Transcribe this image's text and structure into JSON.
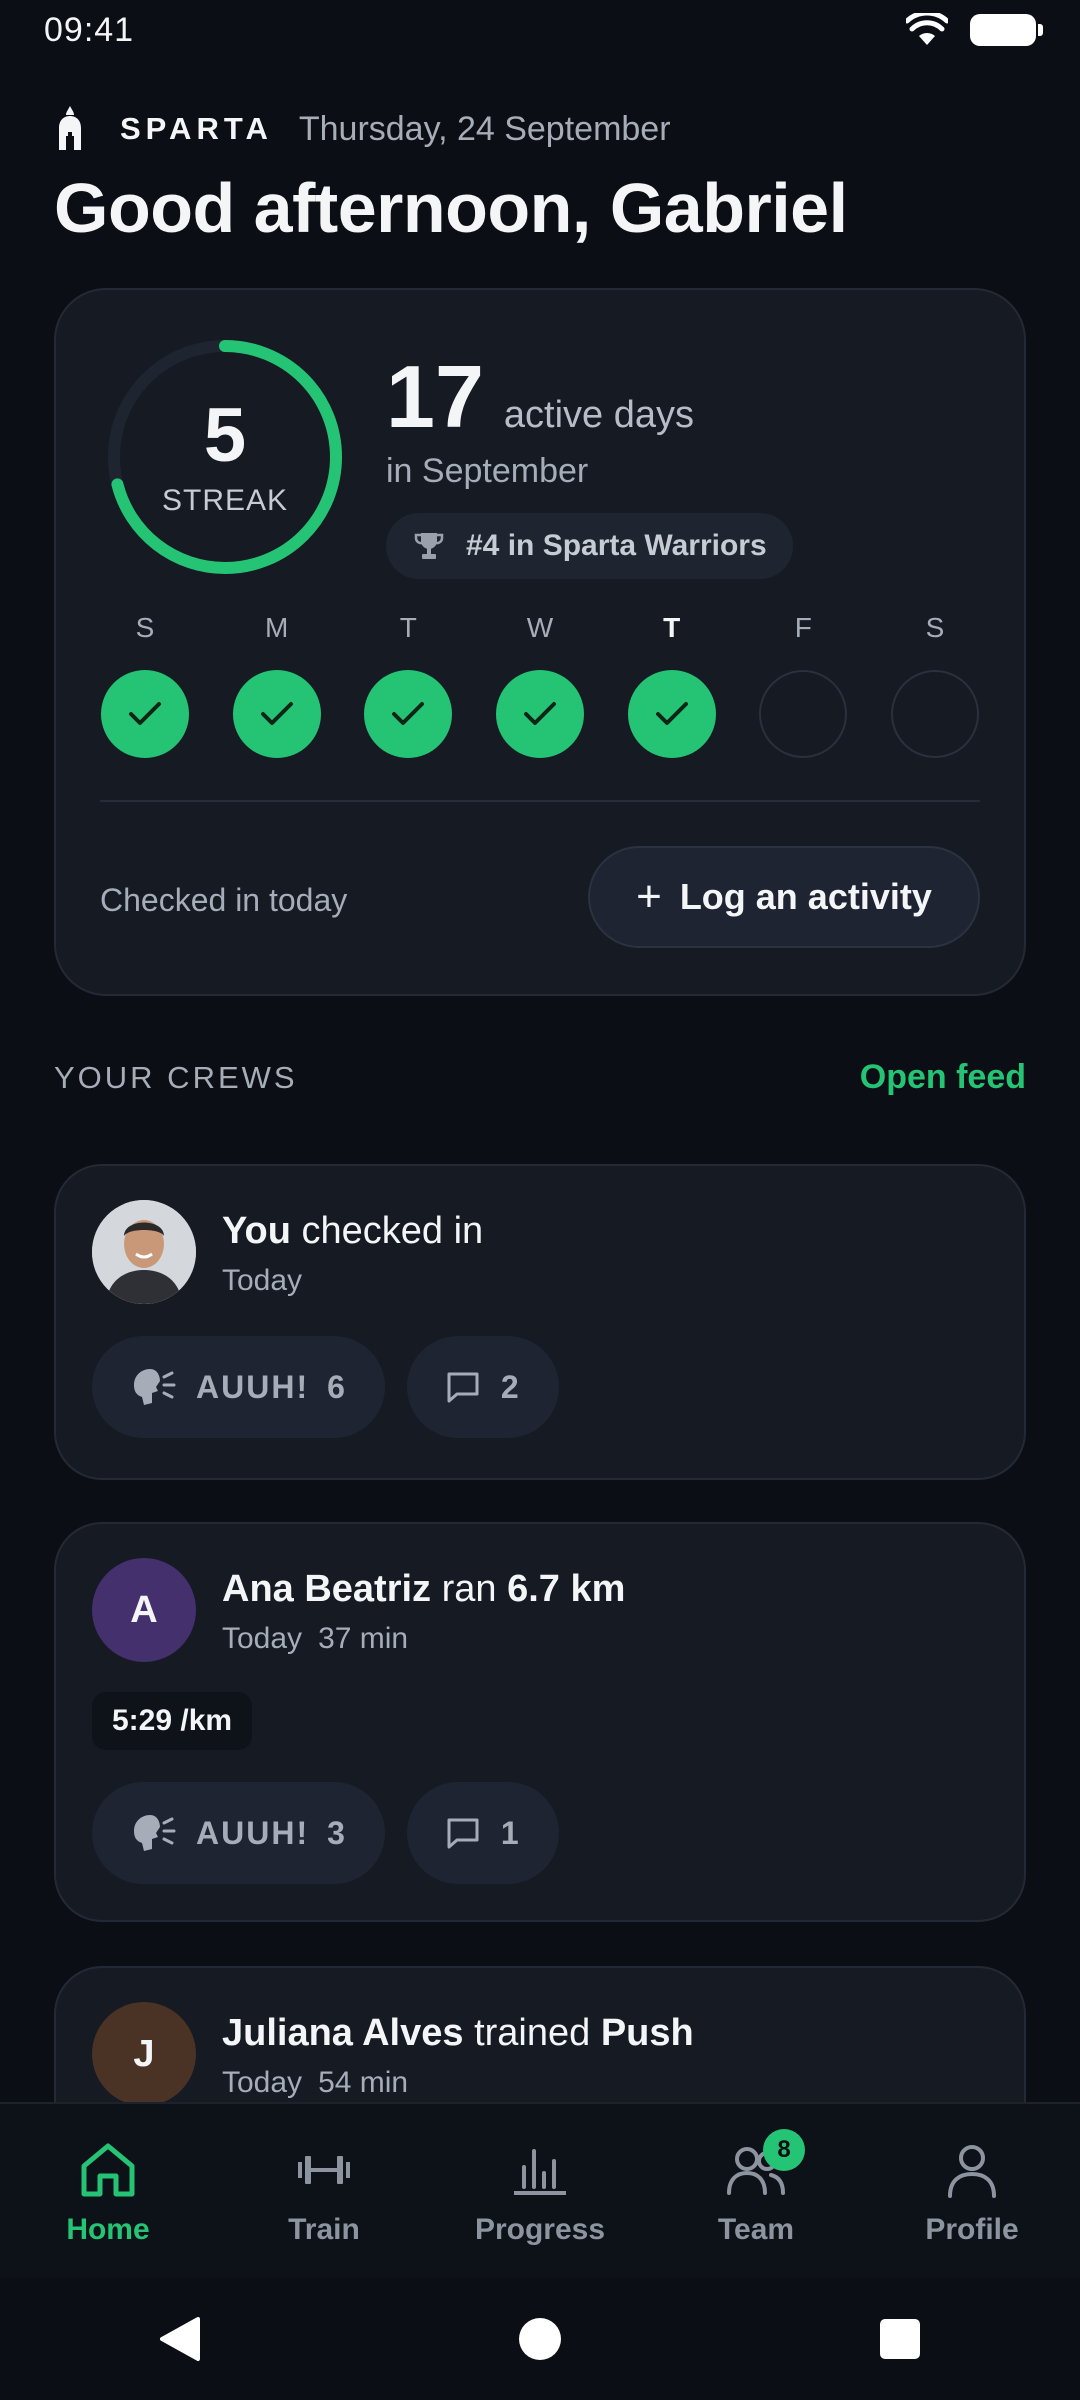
{
  "status_bar": {
    "time": "09:41",
    "wifi_icon": "wifi-icon",
    "battery_icon": "battery-icon"
  },
  "header": {
    "brand": "SPARTA",
    "date": "Thursday, 24 September",
    "greeting": "Good afternoon, Gabriel"
  },
  "streak": {
    "value": "5",
    "label": "STREAK",
    "progress": 0.71,
    "active_days": "17",
    "active_unit": "active days",
    "period": "in September",
    "rank": "#4 in Sparta Warriors",
    "week": [
      {
        "letter": "S",
        "done": true,
        "today": false
      },
      {
        "letter": "M",
        "done": true,
        "today": false
      },
      {
        "letter": "T",
        "done": true,
        "today": false
      },
      {
        "letter": "W",
        "done": true,
        "today": false
      },
      {
        "letter": "T",
        "done": true,
        "today": true
      },
      {
        "letter": "F",
        "done": false,
        "today": false
      },
      {
        "letter": "S",
        "done": false,
        "today": false
      }
    ],
    "checked_in_text": "Checked in today",
    "log_button": "Log an activity"
  },
  "crews": {
    "title": "YOUR CREWS",
    "open_feed": "Open feed"
  },
  "feed": [
    {
      "name": "You",
      "action": "checked in",
      "activity": "",
      "meta": [
        "Today"
      ],
      "auuh_label": "AUUH!",
      "auuh_count": "6",
      "comments": "2"
    },
    {
      "initial": "A",
      "name": "Ana Beatriz",
      "action": "ran",
      "activity": "6.7 km",
      "meta": [
        "Today",
        "37 min"
      ],
      "pace": "5:29 /km",
      "auuh_label": "AUUH!",
      "auuh_count": "3",
      "comments": "1"
    },
    {
      "initial": "J",
      "name": "Juliana Alves",
      "action": "trained",
      "activity": "Push",
      "meta": [
        "Today",
        "54 min"
      ]
    }
  ],
  "nav": {
    "home": "Home",
    "train": "Train",
    "progress": "Progress",
    "team": "Team",
    "team_badge": "8",
    "profile": "Profile"
  },
  "colors": {
    "accent": "#25c475",
    "background": "#0b0e14",
    "card": "#151a23"
  }
}
